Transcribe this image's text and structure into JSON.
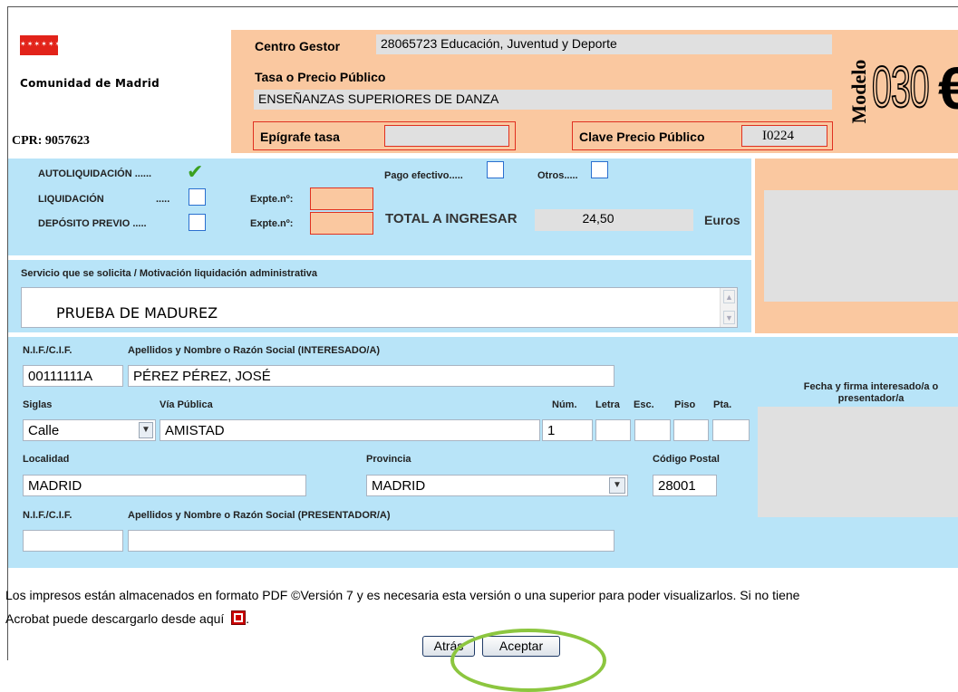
{
  "header": {
    "org_name": "Comunidad de Madrid",
    "cpr": "CPR: 9057623",
    "centro_gestor_label": "Centro Gestor",
    "centro_gestor_value": "28065723 Educación, Juventud y Deporte",
    "tasa_label": "Tasa o Precio Público",
    "tasa_value": "ENSEÑANZAS SUPERIORES DE DANZA",
    "epigrafe_label": "Epígrafe tasa",
    "epigrafe_value": "",
    "clave_label": "Clave Precio Público",
    "clave_value": "I0224",
    "modelo_word": "Modelo",
    "modelo_num": "030",
    "euro_sign": "€"
  },
  "liquidacion": {
    "autoliquidacion": "AUTOLIQUIDACIÓN ......",
    "liquidacion": "LIQUIDACIÓN",
    "liquidacion_dots": ".....",
    "deposito": "DEPÓSITO PREVIO .....",
    "expte1": "Expte.nº:",
    "expte2": "Expte.nº:",
    "pago_efectivo": "Pago efectivo.....",
    "otros": "Otros.....",
    "total_label": "TOTAL A INGRESAR",
    "total_value": "24,50",
    "euros": "Euros",
    "checkmark": "✔"
  },
  "servicio": {
    "label": "Servicio que se solicita / Motivación liquidación administrativa",
    "value": "PRUEBA DE MADUREZ"
  },
  "interesado": {
    "nif_label": "N.I.F./C.I.F.",
    "nombre_label": "Apellidos y Nombre o Razón Social (INTERESADO/A)",
    "nif": "00111111A",
    "nombre": "PÉREZ PÉREZ, JOSÉ",
    "siglas_label": "Siglas",
    "via_label": "Vía Pública",
    "num_label": "Núm.",
    "letra_label": "Letra",
    "esc_label": "Esc.",
    "piso_label": "Piso",
    "pta_label": "Pta.",
    "siglas": "Calle",
    "via": "AMISTAD",
    "num": "1",
    "letra": "",
    "esc": "",
    "piso": "",
    "pta": "",
    "localidad_label": "Localidad",
    "provincia_label": "Provincia",
    "cp_label": "Código Postal",
    "localidad": "MADRID",
    "provincia": "MADRID",
    "cp": "28001"
  },
  "presentador": {
    "nif_label": "N.I.F./C.I.F.",
    "nombre_label": "Apellidos y Nombre o Razón Social (PRESENTADOR/A)",
    "nif": "",
    "nombre": ""
  },
  "firma": {
    "label": "Fecha y firma interesado/a o presentador/a"
  },
  "footer": {
    "line1": "Los impresos están almacenados en formato PDF ©Versión 7 y es necesaria esta versión o una superior para poder visualizarlos. Si no tiene",
    "line2": "Acrobat puede descargarlo desde aquí",
    "period": ".",
    "atras": "Atrás",
    "aceptar": "Aceptar"
  },
  "colors": {
    "peach": "#fac8a0",
    "lightblue": "#b8e4f8",
    "red_border": "#e03020",
    "highlight_ellipse": "#8cc63f"
  }
}
